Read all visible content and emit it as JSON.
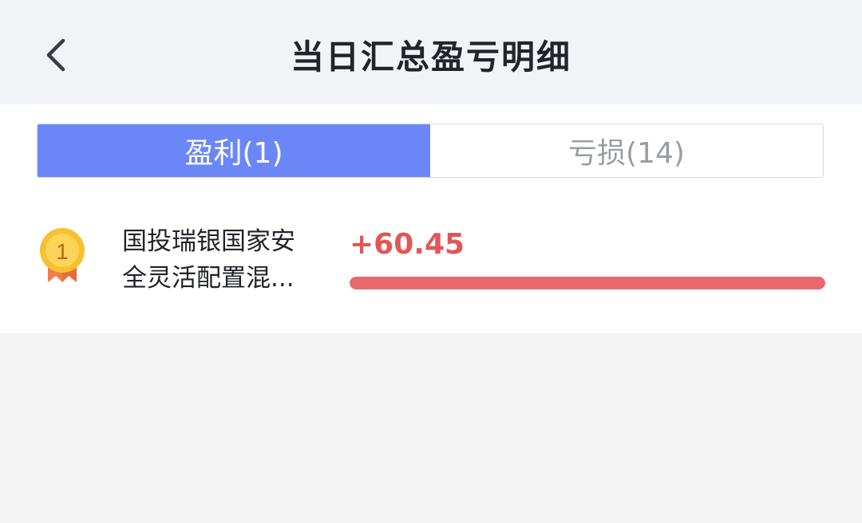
{
  "header": {
    "title": "当日汇总盈亏明细",
    "back_icon": "chevron-left-icon"
  },
  "tabs": [
    {
      "label": "盈利(1)",
      "active": true
    },
    {
      "label": "亏损(14)",
      "active": false
    }
  ],
  "items": [
    {
      "rank": "1",
      "rank_icon": "gold-medal-icon",
      "name_line1": "国投瑞银国家安",
      "name_line2": "全灵活配置混...",
      "value": "+60.45",
      "bar_fraction": 1.0,
      "color": "#e8686c"
    }
  ],
  "colors": {
    "accent": "#6b87f7",
    "profit": "#e25656"
  }
}
